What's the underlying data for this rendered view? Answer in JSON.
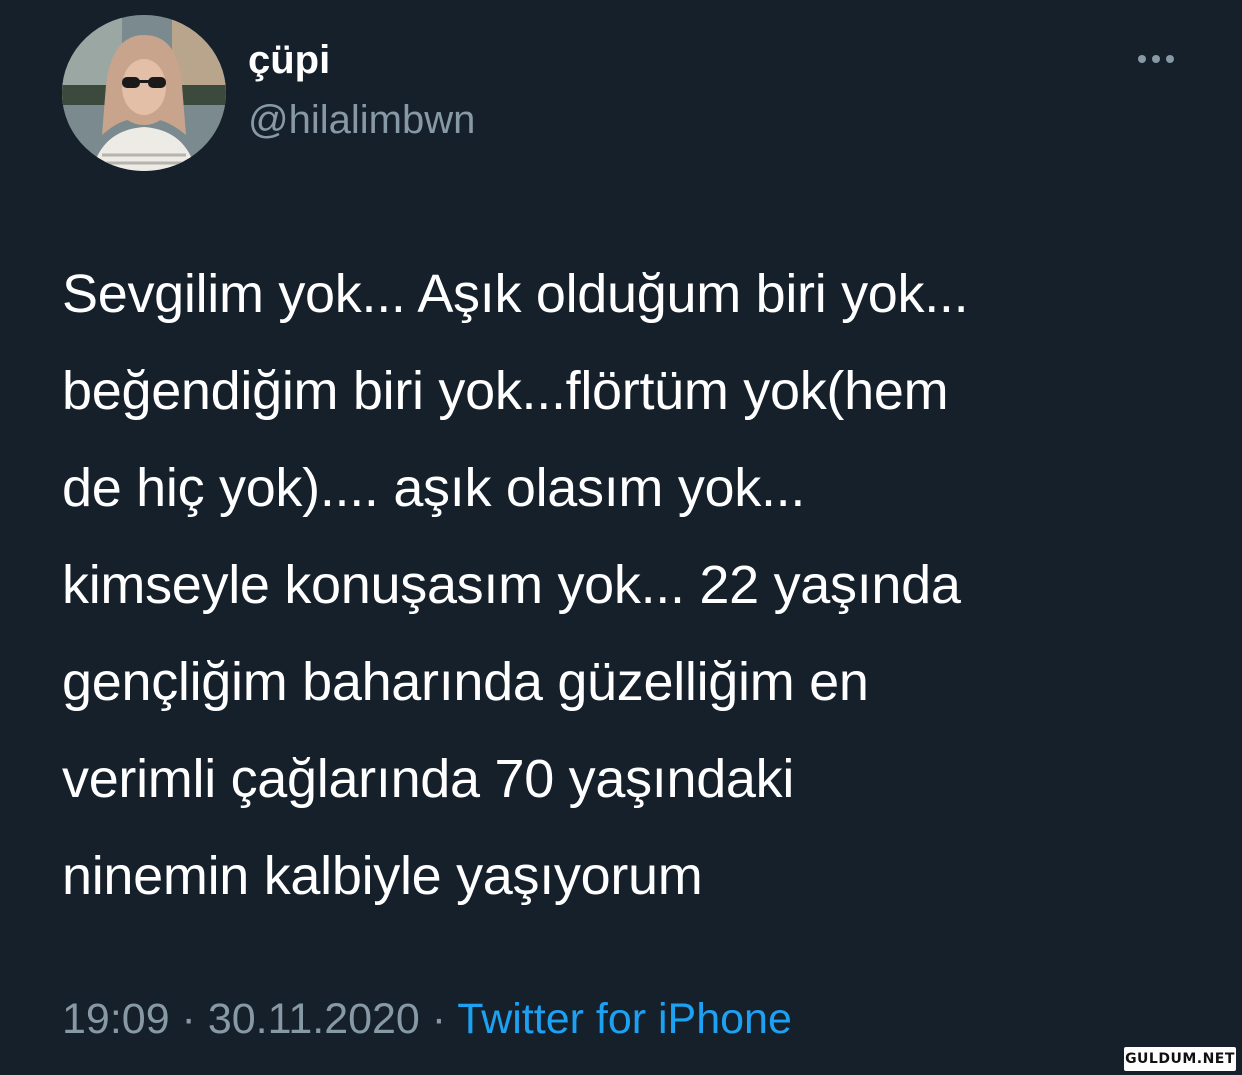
{
  "author": {
    "display_name": "çüpi",
    "handle": "@hilalimbwn",
    "avatar_icon": "profile-photo"
  },
  "more_icon": "more-horizontal-icon",
  "tweet": {
    "text": "Sevgilim yok... Aşık olduğum biri yok...\nbeğendiğim biri yok...flörtüm yok(hem\nde hiç yok).... aşık olasım yok...\nkimseyle konuşasım yok... 22 yaşında\ngençliğim baharında güzelliğim en\nverimli çağlarında 70 yaşındaki\nninemin kalbiyle yaşıyorum"
  },
  "meta": {
    "time": "19:09",
    "separator": " · ",
    "date": "30.11.2020",
    "source": "Twitter for iPhone"
  },
  "watermark": "GULDUM.NET",
  "colors": {
    "background": "#15202b",
    "text": "#ffffff",
    "secondary": "#8899a6",
    "link": "#1da1f2"
  }
}
